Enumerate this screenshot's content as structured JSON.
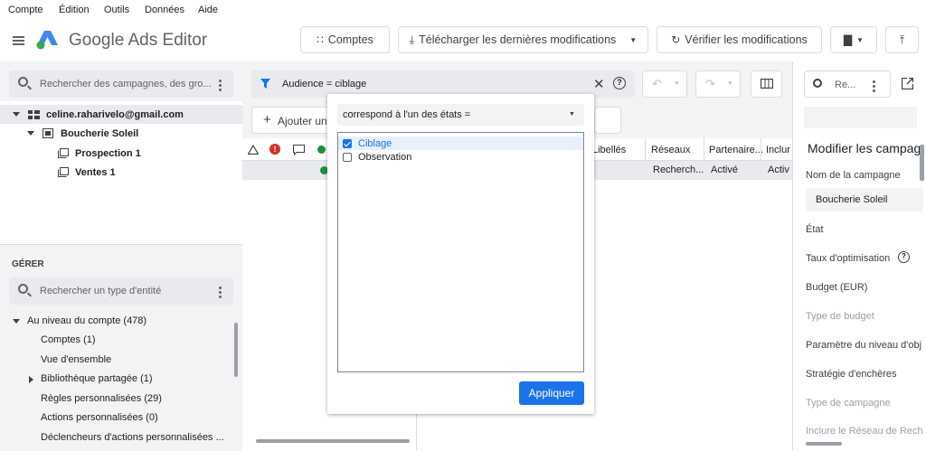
{
  "menu": [
    "Compte",
    "Édition",
    "Outils",
    "Données",
    "Aide"
  ],
  "app": {
    "name": "Google Ads Editor"
  },
  "toolbar": {
    "accounts_label": "Comptes",
    "download_label": "Télécharger les dernières modifications",
    "verify_label": "Vérifier les modifications"
  },
  "left": {
    "search_placeholder": "Rechercher des campagnes, des gro...",
    "account_email": "celine.raharivelo@gmail.com",
    "campaign": "Boucherie Soleil",
    "adgroups": [
      "Prospection 1",
      "Ventes 1"
    ],
    "manage_title": "GÉRER",
    "entity_search_placeholder": "Rechercher un type d'entité",
    "account_level": "Au niveau du compte (478)",
    "manage_items": [
      "Comptes (1)",
      "Vue d'ensemble",
      "Bibliothèque partagée (1)",
      "Règles personnalisées (29)",
      "Actions personnalisées (0)",
      "Déclencheurs d'actions personnalisées ..."
    ]
  },
  "center": {
    "filter_text": "Audience = ciblage",
    "add_label": "Ajouter un",
    "columns": [
      "Libellés",
      "Réseaux",
      "Partenaire...",
      "Inclur"
    ],
    "row": [
      "Recherch...",
      "Activé",
      "Activ"
    ]
  },
  "popup": {
    "operator": "correspond à l'un des états  =",
    "options": [
      {
        "label": "Ciblage",
        "checked": true
      },
      {
        "label": "Observation",
        "checked": false
      }
    ],
    "apply_label": "Appliquer"
  },
  "right": {
    "search_placeholder": "Re...",
    "title": "Modifier les campag",
    "campaign_name_label": "Nom de la campagne",
    "campaign_name_value": "Boucherie Soleil",
    "fields": [
      {
        "label": "État",
        "dim": false
      },
      {
        "label": "Taux d'optimisation",
        "dim": false
      },
      {
        "label": "Budget (EUR)",
        "dim": false
      },
      {
        "label": "Type de budget",
        "dim": true
      },
      {
        "label": "Paramètre du niveau d'obj",
        "dim": false
      },
      {
        "label": "Stratégie d'enchères",
        "dim": false
      },
      {
        "label": "Type de campagne",
        "dim": true
      },
      {
        "label": "Inclure le Réseau de Rech",
        "dim": true
      }
    ]
  },
  "colors": {
    "primary": "#1a73e8",
    "status_green": "#1e8e3e",
    "error_red": "#d93025",
    "filter_icon": "#1a73e8"
  }
}
